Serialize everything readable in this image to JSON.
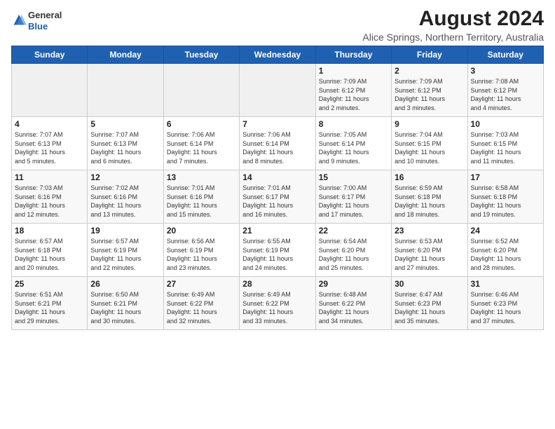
{
  "header": {
    "logo": {
      "general": "General",
      "blue": "Blue"
    },
    "title": "August 2024",
    "subtitle": "Alice Springs, Northern Territory, Australia"
  },
  "calendar": {
    "headers": [
      "Sunday",
      "Monday",
      "Tuesday",
      "Wednesday",
      "Thursday",
      "Friday",
      "Saturday"
    ],
    "rows": [
      [
        {
          "day": "",
          "info": ""
        },
        {
          "day": "",
          "info": ""
        },
        {
          "day": "",
          "info": ""
        },
        {
          "day": "",
          "info": ""
        },
        {
          "day": "1",
          "info": "Sunrise: 7:09 AM\nSunset: 6:12 PM\nDaylight: 11 hours\nand 2 minutes."
        },
        {
          "day": "2",
          "info": "Sunrise: 7:09 AM\nSunset: 6:12 PM\nDaylight: 11 hours\nand 3 minutes."
        },
        {
          "day": "3",
          "info": "Sunrise: 7:08 AM\nSunset: 6:12 PM\nDaylight: 11 hours\nand 4 minutes."
        }
      ],
      [
        {
          "day": "4",
          "info": "Sunrise: 7:07 AM\nSunset: 6:13 PM\nDaylight: 11 hours\nand 5 minutes."
        },
        {
          "day": "5",
          "info": "Sunrise: 7:07 AM\nSunset: 6:13 PM\nDaylight: 11 hours\nand 6 minutes."
        },
        {
          "day": "6",
          "info": "Sunrise: 7:06 AM\nSunset: 6:14 PM\nDaylight: 11 hours\nand 7 minutes."
        },
        {
          "day": "7",
          "info": "Sunrise: 7:06 AM\nSunset: 6:14 PM\nDaylight: 11 hours\nand 8 minutes."
        },
        {
          "day": "8",
          "info": "Sunrise: 7:05 AM\nSunset: 6:14 PM\nDaylight: 11 hours\nand 9 minutes."
        },
        {
          "day": "9",
          "info": "Sunrise: 7:04 AM\nSunset: 6:15 PM\nDaylight: 11 hours\nand 10 minutes."
        },
        {
          "day": "10",
          "info": "Sunrise: 7:03 AM\nSunset: 6:15 PM\nDaylight: 11 hours\nand 11 minutes."
        }
      ],
      [
        {
          "day": "11",
          "info": "Sunrise: 7:03 AM\nSunset: 6:16 PM\nDaylight: 11 hours\nand 12 minutes."
        },
        {
          "day": "12",
          "info": "Sunrise: 7:02 AM\nSunset: 6:16 PM\nDaylight: 11 hours\nand 13 minutes."
        },
        {
          "day": "13",
          "info": "Sunrise: 7:01 AM\nSunset: 6:16 PM\nDaylight: 11 hours\nand 15 minutes."
        },
        {
          "day": "14",
          "info": "Sunrise: 7:01 AM\nSunset: 6:17 PM\nDaylight: 11 hours\nand 16 minutes."
        },
        {
          "day": "15",
          "info": "Sunrise: 7:00 AM\nSunset: 6:17 PM\nDaylight: 11 hours\nand 17 minutes."
        },
        {
          "day": "16",
          "info": "Sunrise: 6:59 AM\nSunset: 6:18 PM\nDaylight: 11 hours\nand 18 minutes."
        },
        {
          "day": "17",
          "info": "Sunrise: 6:58 AM\nSunset: 6:18 PM\nDaylight: 11 hours\nand 19 minutes."
        }
      ],
      [
        {
          "day": "18",
          "info": "Sunrise: 6:57 AM\nSunset: 6:18 PM\nDaylight: 11 hours\nand 20 minutes."
        },
        {
          "day": "19",
          "info": "Sunrise: 6:57 AM\nSunset: 6:19 PM\nDaylight: 11 hours\nand 22 minutes."
        },
        {
          "day": "20",
          "info": "Sunrise: 6:56 AM\nSunset: 6:19 PM\nDaylight: 11 hours\nand 23 minutes."
        },
        {
          "day": "21",
          "info": "Sunrise: 6:55 AM\nSunset: 6:19 PM\nDaylight: 11 hours\nand 24 minutes."
        },
        {
          "day": "22",
          "info": "Sunrise: 6:54 AM\nSunset: 6:20 PM\nDaylight: 11 hours\nand 25 minutes."
        },
        {
          "day": "23",
          "info": "Sunrise: 6:53 AM\nSunset: 6:20 PM\nDaylight: 11 hours\nand 27 minutes."
        },
        {
          "day": "24",
          "info": "Sunrise: 6:52 AM\nSunset: 6:20 PM\nDaylight: 11 hours\nand 28 minutes."
        }
      ],
      [
        {
          "day": "25",
          "info": "Sunrise: 6:51 AM\nSunset: 6:21 PM\nDaylight: 11 hours\nand 29 minutes."
        },
        {
          "day": "26",
          "info": "Sunrise: 6:50 AM\nSunset: 6:21 PM\nDaylight: 11 hours\nand 30 minutes."
        },
        {
          "day": "27",
          "info": "Sunrise: 6:49 AM\nSunset: 6:22 PM\nDaylight: 11 hours\nand 32 minutes."
        },
        {
          "day": "28",
          "info": "Sunrise: 6:49 AM\nSunset: 6:22 PM\nDaylight: 11 hours\nand 33 minutes."
        },
        {
          "day": "29",
          "info": "Sunrise: 6:48 AM\nSunset: 6:22 PM\nDaylight: 11 hours\nand 34 minutes."
        },
        {
          "day": "30",
          "info": "Sunrise: 6:47 AM\nSunset: 6:23 PM\nDaylight: 11 hours\nand 35 minutes."
        },
        {
          "day": "31",
          "info": "Sunrise: 6:46 AM\nSunset: 6:23 PM\nDaylight: 11 hours\nand 37 minutes."
        }
      ]
    ]
  }
}
